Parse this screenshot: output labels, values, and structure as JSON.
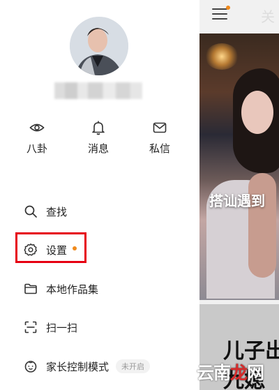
{
  "drawer": {
    "quick_actions": [
      {
        "label": "八卦",
        "icon": "eye-icon"
      },
      {
        "label": "消息",
        "icon": "bell-icon"
      },
      {
        "label": "私信",
        "icon": "mail-icon"
      }
    ],
    "menu": {
      "search": "查找",
      "settings": "设置",
      "local_works": "本地作品集",
      "scan": "扫一扫",
      "parental_control": "家长控制模式",
      "parental_control_status": "未开启"
    }
  },
  "feed": {
    "top_tab_fragment": "关",
    "card1_caption": "搭讪遇到",
    "card2_caption_line1": "儿子出",
    "card2_caption_line2": "九媳"
  },
  "watermark": {
    "part1": "云南",
    "part2": "龙",
    "part3": "网"
  },
  "colors": {
    "accent_dot": "#f08a1c",
    "highlight_box": "#e60012"
  }
}
